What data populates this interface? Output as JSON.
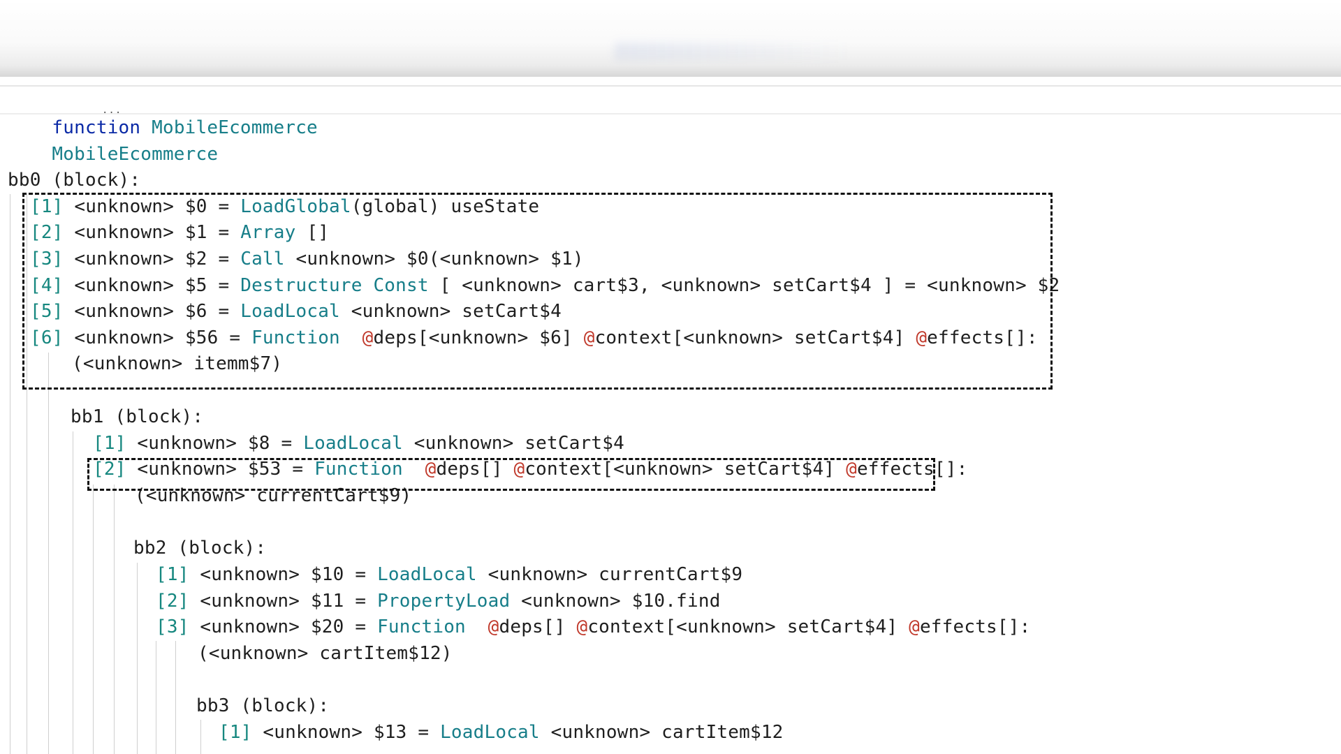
{
  "editor": {
    "header": {
      "keyword": "function",
      "name": "MobileEcommerce",
      "subtitle": "MobileEcommerce"
    },
    "lines": [
      {
        "id": "bb0",
        "tokens": [
          {
            "t": "bb0 (block):",
            "c": "tx"
          }
        ]
      },
      {
        "id": "bb0-1",
        "tokens": [
          {
            "t": "[1]",
            "c": "op"
          },
          {
            "t": " <unknown> $0 = ",
            "c": "tx"
          },
          {
            "t": "LoadGlobal",
            "c": "fn"
          },
          {
            "t": "(global) useState",
            "c": "tx"
          }
        ]
      },
      {
        "id": "bb0-2",
        "tokens": [
          {
            "t": "[2]",
            "c": "op"
          },
          {
            "t": " <unknown> $1 = ",
            "c": "tx"
          },
          {
            "t": "Array",
            "c": "fn"
          },
          {
            "t": " []",
            "c": "tx"
          }
        ]
      },
      {
        "id": "bb0-3",
        "tokens": [
          {
            "t": "[3]",
            "c": "op"
          },
          {
            "t": " <unknown> $2 = ",
            "c": "tx"
          },
          {
            "t": "Call",
            "c": "fn"
          },
          {
            "t": " <unknown> $0(<unknown> $1)",
            "c": "tx"
          }
        ]
      },
      {
        "id": "bb0-4",
        "tokens": [
          {
            "t": "[4]",
            "c": "op"
          },
          {
            "t": " <unknown> $5 = ",
            "c": "tx"
          },
          {
            "t": "Destructure Const",
            "c": "fn"
          },
          {
            "t": " [ <unknown> cart$3, <unknown> setCart$4 ] = <unknown> $2",
            "c": "tx"
          }
        ]
      },
      {
        "id": "bb0-5",
        "tokens": [
          {
            "t": "[5]",
            "c": "op"
          },
          {
            "t": " <unknown> $6 = ",
            "c": "tx"
          },
          {
            "t": "LoadLocal",
            "c": "fn"
          },
          {
            "t": " <unknown> setCart$4",
            "c": "tx"
          }
        ]
      },
      {
        "id": "bb0-6",
        "tokens": [
          {
            "t": "[6]",
            "c": "op"
          },
          {
            "t": " <unknown> $56 = ",
            "c": "tx"
          },
          {
            "t": "Function",
            "c": "fn"
          },
          {
            "t": "  ",
            "c": "tx"
          },
          {
            "t": "@",
            "c": "at"
          },
          {
            "t": "deps[<unknown> $6] ",
            "c": "tx"
          },
          {
            "t": "@",
            "c": "at"
          },
          {
            "t": "context[<unknown> setCart$4] ",
            "c": "tx"
          },
          {
            "t": "@",
            "c": "at"
          },
          {
            "t": "effects[]:",
            "c": "tx"
          }
        ]
      },
      {
        "id": "bb0-6b",
        "tokens": [
          {
            "t": "(<unknown> itemm$7)",
            "c": "tx"
          }
        ]
      },
      {
        "id": "bb1",
        "tokens": [
          {
            "t": "bb1 (block):",
            "c": "tx"
          }
        ]
      },
      {
        "id": "bb1-1",
        "tokens": [
          {
            "t": "[1]",
            "c": "op"
          },
          {
            "t": " <unknown> $8 = ",
            "c": "tx"
          },
          {
            "t": "LoadLocal",
            "c": "fn"
          },
          {
            "t": " <unknown> setCart$4",
            "c": "tx"
          }
        ]
      },
      {
        "id": "bb1-2",
        "tokens": [
          {
            "t": "[2]",
            "c": "op"
          },
          {
            "t": " <unknown> $53 = ",
            "c": "tx"
          },
          {
            "t": "Function",
            "c": "fn"
          },
          {
            "t": "  ",
            "c": "tx"
          },
          {
            "t": "@",
            "c": "at"
          },
          {
            "t": "deps[] ",
            "c": "tx"
          },
          {
            "t": "@",
            "c": "at"
          },
          {
            "t": "context[<unknown> setCart$4] ",
            "c": "tx"
          },
          {
            "t": "@",
            "c": "at"
          },
          {
            "t": "effects[]:",
            "c": "tx"
          }
        ]
      },
      {
        "id": "bb1-2b",
        "tokens": [
          {
            "t": "(<unknown> currentCart$9)",
            "c": "tx"
          }
        ]
      },
      {
        "id": "bb2",
        "tokens": [
          {
            "t": "bb2 (block):",
            "c": "tx"
          }
        ]
      },
      {
        "id": "bb2-1",
        "tokens": [
          {
            "t": "[1]",
            "c": "op"
          },
          {
            "t": " <unknown> $10 = ",
            "c": "tx"
          },
          {
            "t": "LoadLocal",
            "c": "fn"
          },
          {
            "t": " <unknown> currentCart$9",
            "c": "tx"
          }
        ]
      },
      {
        "id": "bb2-2",
        "tokens": [
          {
            "t": "[2]",
            "c": "op"
          },
          {
            "t": " <unknown> $11 = ",
            "c": "tx"
          },
          {
            "t": "PropertyLoad",
            "c": "fn"
          },
          {
            "t": " <unknown> $10.find",
            "c": "tx"
          }
        ]
      },
      {
        "id": "bb2-3",
        "tokens": [
          {
            "t": "[3]",
            "c": "op"
          },
          {
            "t": " <unknown> $20 = ",
            "c": "tx"
          },
          {
            "t": "Function",
            "c": "fn"
          },
          {
            "t": "  ",
            "c": "tx"
          },
          {
            "t": "@",
            "c": "at"
          },
          {
            "t": "deps[] ",
            "c": "tx"
          },
          {
            "t": "@",
            "c": "at"
          },
          {
            "t": "context[<unknown> setCart$4] ",
            "c": "tx"
          },
          {
            "t": "@",
            "c": "at"
          },
          {
            "t": "effects[]:",
            "c": "tx"
          }
        ]
      },
      {
        "id": "bb2-3b",
        "tokens": [
          {
            "t": "(<unknown> cartItem$12)",
            "c": "tx"
          }
        ]
      },
      {
        "id": "bb3",
        "tokens": [
          {
            "t": "bb3 (block):",
            "c": "tx"
          }
        ]
      },
      {
        "id": "bb3-1",
        "tokens": [
          {
            "t": "[1]",
            "c": "op"
          },
          {
            "t": " <unknown> $13 = ",
            "c": "tx"
          },
          {
            "t": "LoadLocal",
            "c": "fn"
          },
          {
            "t": " <unknown> cartItem$12",
            "c": "tx"
          }
        ]
      }
    ]
  }
}
